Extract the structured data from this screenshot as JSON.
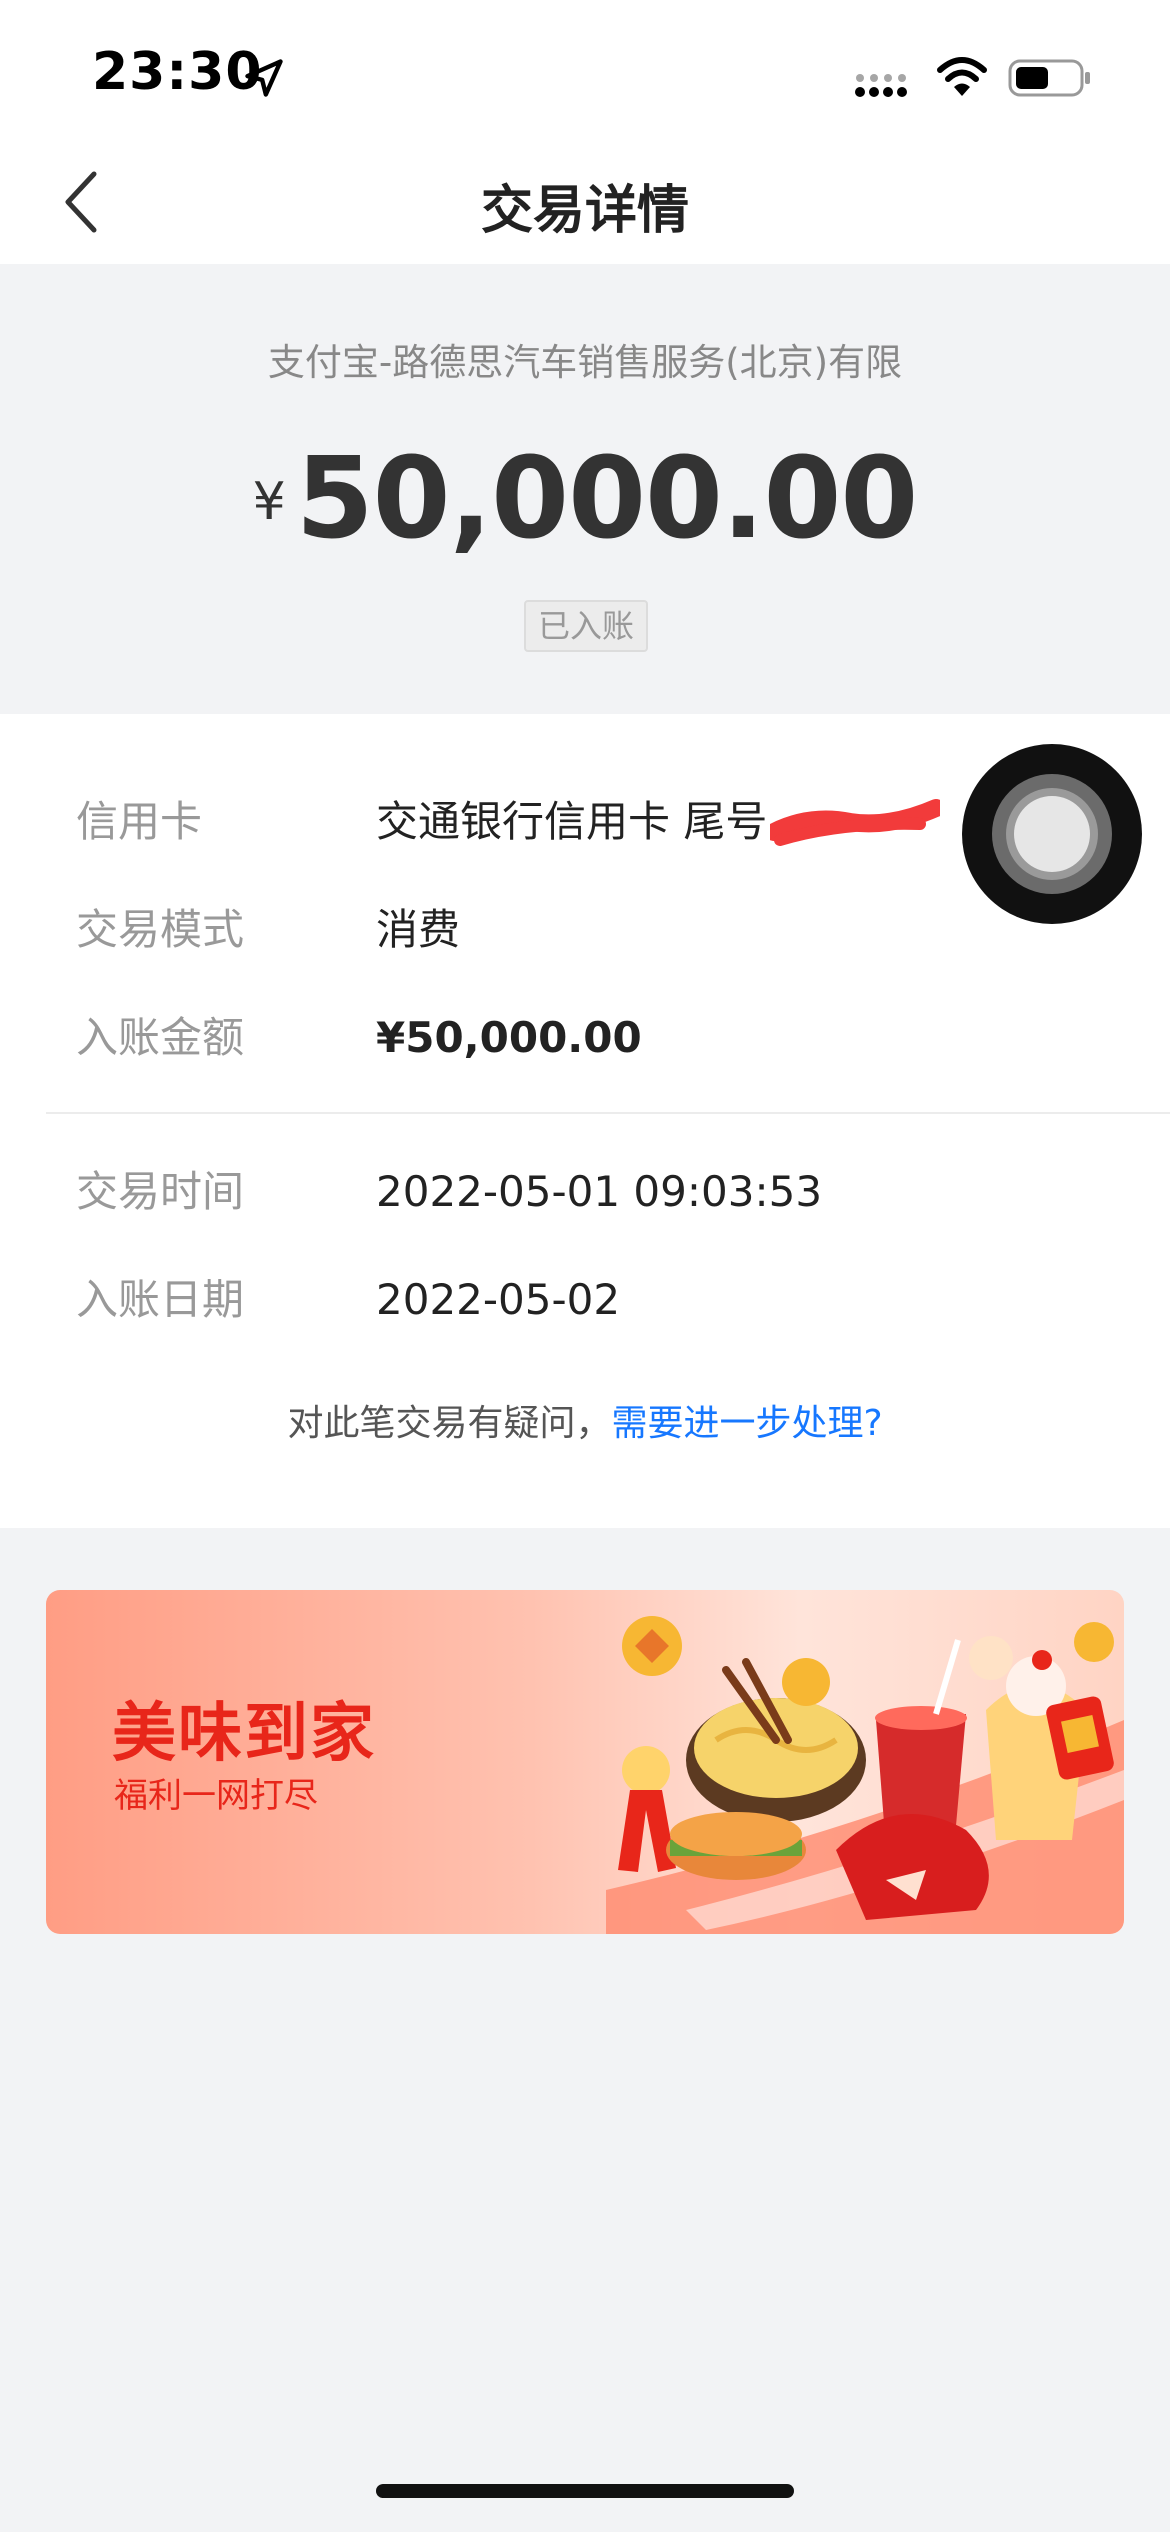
{
  "status_bar": {
    "time": "23:30"
  },
  "nav": {
    "title": "交易详情"
  },
  "summary": {
    "merchant": "支付宝-路德思汽车销售服务(北京)有限",
    "currency_symbol": "¥",
    "amount": "50,000.00",
    "status": "已入账"
  },
  "details": {
    "card": {
      "label": "信用卡",
      "value": "交通银行信用卡 尾号"
    },
    "mode": {
      "label": "交易模式",
      "value": "消费"
    },
    "posted_amount": {
      "label": "入账金额",
      "value": "¥50,000.00"
    },
    "trade_time": {
      "label": "交易时间",
      "value": "2022-05-01 09:03:53"
    },
    "posted_date": {
      "label": "入账日期",
      "value": "2022-05-02"
    }
  },
  "question": {
    "text": "对此笔交易有疑问，",
    "link": "需要进一步处理?"
  },
  "promo": {
    "title": "美味到家",
    "subtitle": "福利一网打尽"
  },
  "colors": {
    "link": "#1677ff",
    "promo_text": "#e8261a",
    "background": "#f2f3f5"
  }
}
